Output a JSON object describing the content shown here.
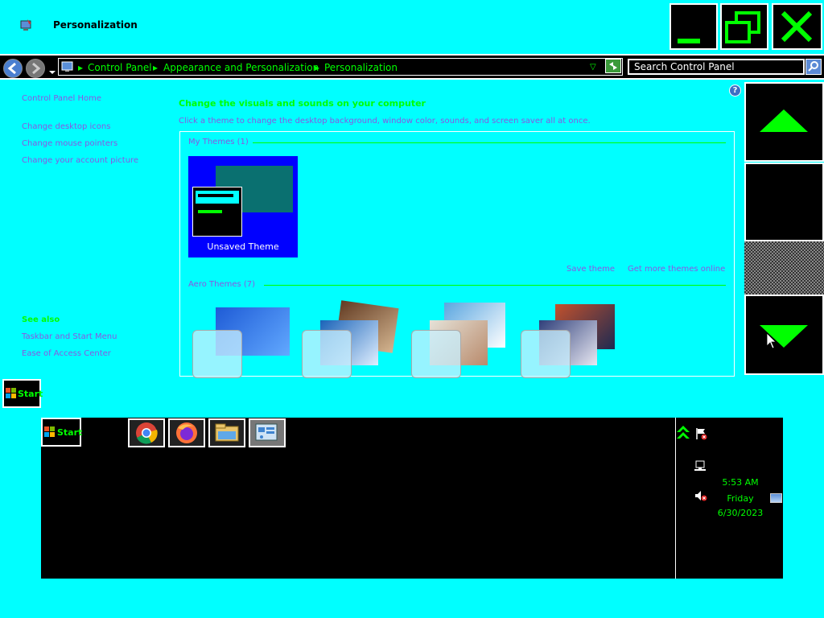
{
  "window": {
    "title": "Personalization"
  },
  "address_bar": {
    "crumbs": [
      "Control Panel",
      "Appearance and Personalization",
      "Personalization"
    ],
    "search_placeholder": "Search Control Panel"
  },
  "left_pane": {
    "home_link": "Control Panel Home",
    "links": [
      "Change desktop icons",
      "Change mouse pointers",
      "Change your account picture"
    ],
    "see_also_heading": "See also",
    "see_also_links": [
      "Taskbar and Start Menu",
      "Ease of Access Center"
    ]
  },
  "main": {
    "heading": "Change the visuals and sounds on your computer",
    "description": "Click a theme to change the desktop background, window color, sounds, and screen saver all at once.",
    "my_themes_heading": "My Themes (1)",
    "unsaved_theme_label": "Unsaved Theme",
    "save_theme_link": "Save theme",
    "get_more_link": "Get more themes online",
    "aero_heading": "Aero Themes (7)"
  },
  "taskbar": {
    "start_label": "Start",
    "apps": [
      "chrome-icon",
      "firefox-icon",
      "file-explorer-icon",
      "control-panel-icon"
    ],
    "clock_time": "5:53 AM",
    "clock_day": "Friday",
    "clock_date": "6/30/2023"
  },
  "colors": {
    "background": "#00ffff",
    "accent_green": "#00ff00",
    "link_purple": "#8a56e2"
  }
}
